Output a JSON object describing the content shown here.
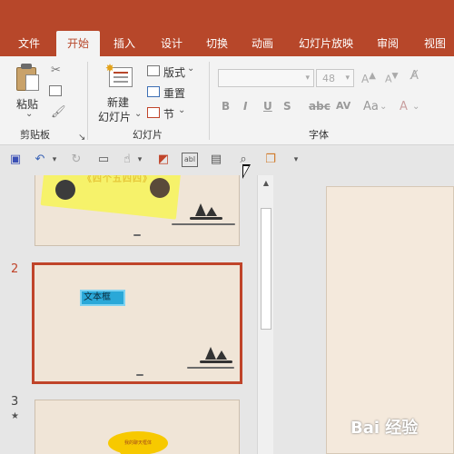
{
  "ribbon_tabs": [
    {
      "label": "文件"
    },
    {
      "label": "开始",
      "active": true
    },
    {
      "label": "插入"
    },
    {
      "label": "设计"
    },
    {
      "label": "切换"
    },
    {
      "label": "动画"
    },
    {
      "label": "幻灯片放映"
    },
    {
      "label": "审阅"
    },
    {
      "label": "视图"
    }
  ],
  "clipboard": {
    "paste_label": "粘贴",
    "group_label": "剪贴板"
  },
  "slides_group": {
    "new_slide_line1": "新建",
    "new_slide_line2": "幻灯片",
    "layout_label": "版式",
    "reset_label": "重置",
    "section_label": "节",
    "group_label": "幻灯片"
  },
  "font_group": {
    "font_size": "48",
    "bold": "B",
    "italic": "I",
    "underline": "U",
    "strike": "S",
    "spacing": "AV",
    "case": "Aa",
    "group_label": "字体"
  },
  "thumbnails": {
    "slide1_banner": "《四个五四四》",
    "slide2_number": "2",
    "slide2_textbox": "文本框",
    "slide3_number": "3",
    "slide3_star": "★",
    "slide3_bubble": "我的聊天框体"
  },
  "watermark": {
    "text": "Bai 经验"
  },
  "colors": {
    "accent": "#b7472a",
    "selection": "#c0442a",
    "slide_bg": "#f0e5d7"
  }
}
